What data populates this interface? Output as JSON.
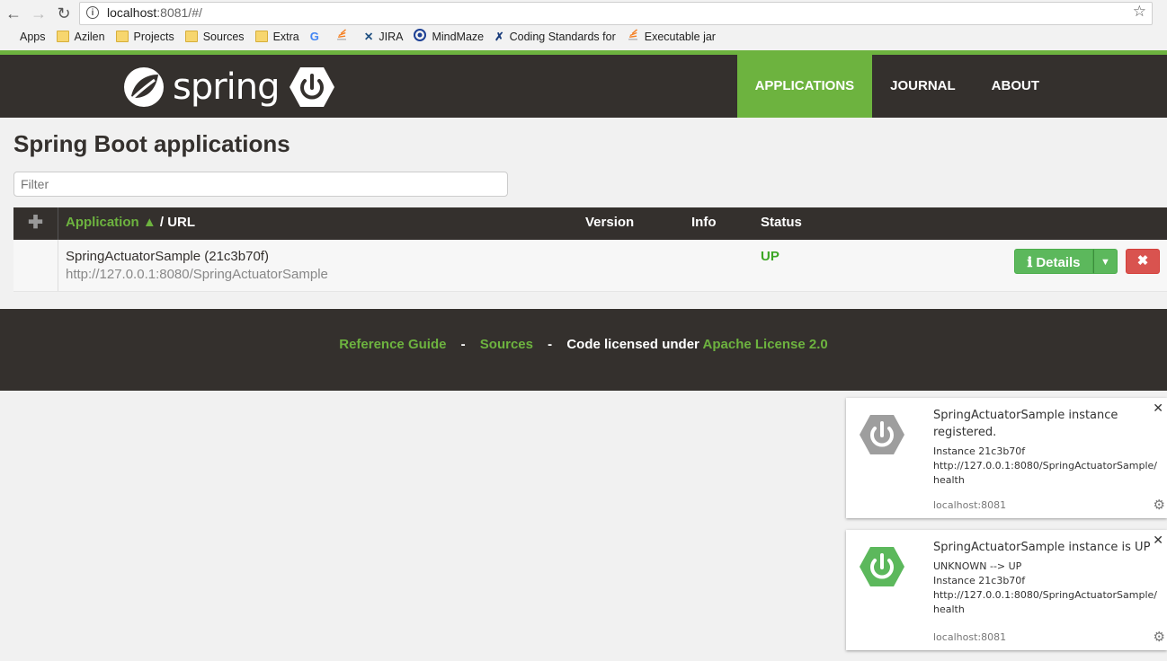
{
  "browser": {
    "url_host": "localhost",
    "url_rest": ":8081/#/",
    "bookmarks": [
      {
        "label": "Apps",
        "icon": "apps-grid-icon"
      },
      {
        "label": "Azilen",
        "icon": "folder-icon"
      },
      {
        "label": "Projects",
        "icon": "folder-icon"
      },
      {
        "label": "Sources",
        "icon": "folder-icon"
      },
      {
        "label": "Extra",
        "icon": "folder-icon"
      },
      {
        "label": "",
        "icon": "google-icon"
      },
      {
        "label": "",
        "icon": "stackoverflow-icon"
      },
      {
        "label": "JIRA",
        "icon": "jira-icon"
      },
      {
        "label": "MindMaze",
        "icon": "mindmaze-icon"
      },
      {
        "label": "Coding Standards for",
        "icon": "coding-standards-icon"
      },
      {
        "label": "Executable jar",
        "icon": "stackoverflow-icon"
      }
    ]
  },
  "navbar": {
    "logo_text": "spring",
    "items": [
      {
        "label": "APPLICATIONS",
        "active": true
      },
      {
        "label": "JOURNAL",
        "active": false
      },
      {
        "label": "ABOUT",
        "active": false
      }
    ]
  },
  "main": {
    "title": "Spring Boot applications",
    "filter_placeholder": "Filter",
    "table": {
      "add_symbol": "✚",
      "col_application": "Application ▲",
      "col_url": " / URL",
      "col_version": "Version",
      "col_info": "Info",
      "col_status": "Status",
      "rows": [
        {
          "name": "SpringActuatorSample (21c3b70f)",
          "url": "http://127.0.0.1:8080/SpringActuatorSample",
          "version": "",
          "info": "",
          "status": "UP",
          "details_label": "Details",
          "remove_symbol": "✖"
        }
      ]
    }
  },
  "footer": {
    "reference_guide": "Reference Guide",
    "sources": "Sources",
    "license_prefix": "Code licensed under",
    "license_link": "Apache License 2.0",
    "separator": "-"
  },
  "notifications": [
    {
      "title": "SpringActuatorSample instance registered.",
      "body": [
        "Instance 21c3b70f",
        "http://127.0.0.1:8080/SpringActuatorSample/",
        "health"
      ],
      "source": "localhost:8081",
      "icon_color": "#9e9e9e"
    },
    {
      "title": "SpringActuatorSample instance is UP",
      "body": [
        "UNKNOWN --> UP",
        "Instance 21c3b70f",
        "http://127.0.0.1:8080/SpringActuatorSample/",
        "health"
      ],
      "source": "localhost:8081",
      "icon_color": "#5cb85c"
    }
  ],
  "colors": {
    "brand_green": "#6db33f",
    "navbar_dark": "#34302d",
    "status_up": "#3ba624",
    "danger": "#d9534f"
  }
}
